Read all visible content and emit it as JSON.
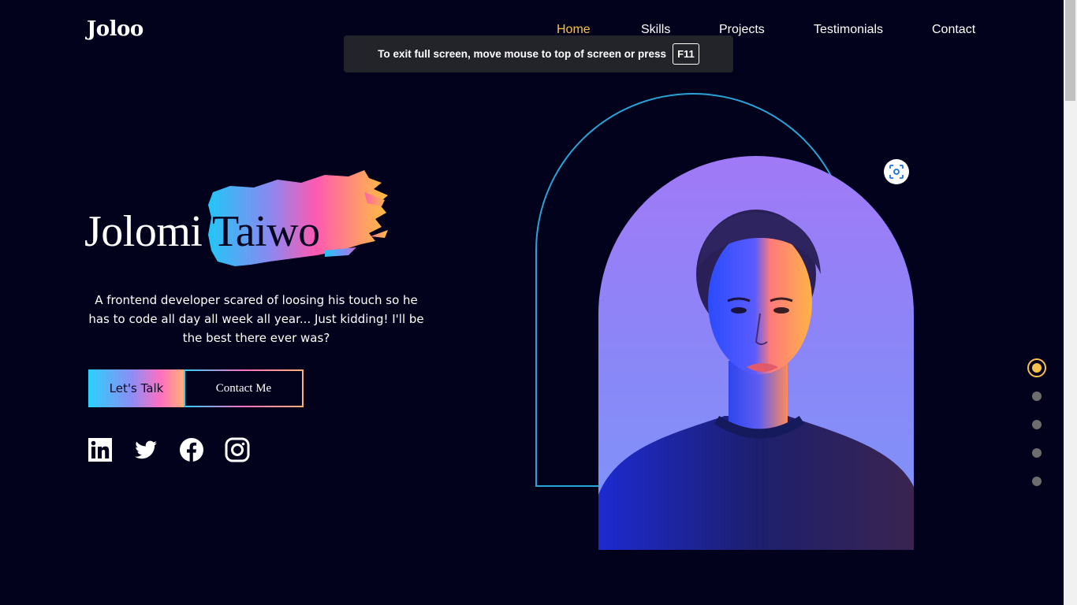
{
  "header": {
    "logo": "Joloo",
    "nav": [
      {
        "label": "Home",
        "active": true
      },
      {
        "label": "Skills",
        "active": false
      },
      {
        "label": "Projects",
        "active": false
      },
      {
        "label": "Testimonials",
        "active": false
      },
      {
        "label": "Contact",
        "active": false
      }
    ]
  },
  "toast": {
    "message": "To exit full screen, move mouse to top of screen or press",
    "key": "F11"
  },
  "hero": {
    "first_name": "Jolomi",
    "last_name": "Taiwo",
    "description": "A frontend developer scared of loosing his touch so he has to code all day all week all year... Just kidding! I'll be the best there ever was?",
    "primary_button": "Let's Talk",
    "secondary_button": "Contact Me",
    "socials": [
      "linkedin-icon",
      "twitter-icon",
      "facebook-icon",
      "instagram-icon"
    ]
  },
  "section_dots": {
    "count": 5,
    "active_index": 0
  },
  "colors": {
    "background": "#03021d",
    "accent": "#f8c24a",
    "arch_outline": "#2aa3d8",
    "gradient": [
      "#2bd1fb",
      "#ff6fc0",
      "#ffb178"
    ]
  }
}
